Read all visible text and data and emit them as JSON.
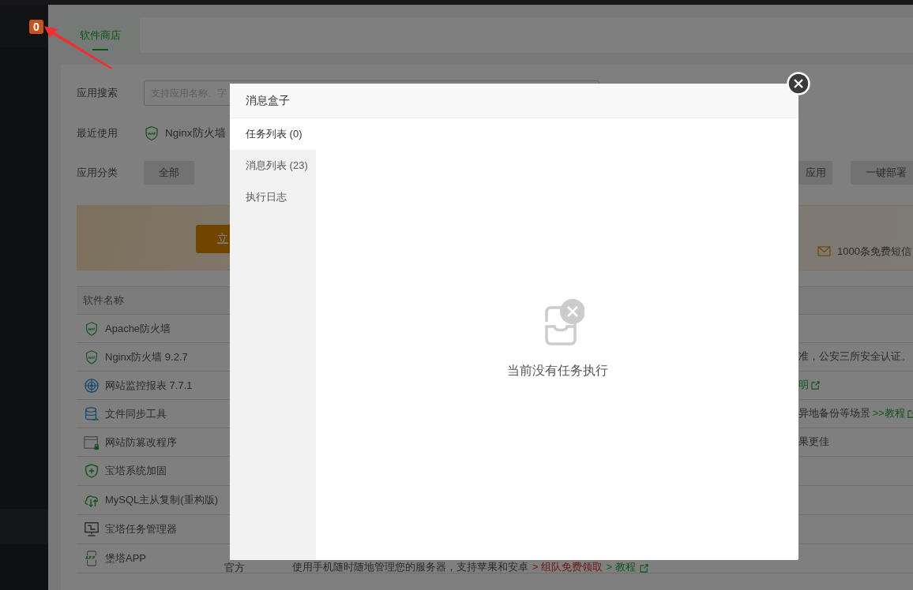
{
  "sidebar": {
    "badge": "0"
  },
  "tabs": [
    {
      "label": "软件商店",
      "selected": true
    }
  ],
  "search": {
    "label": "应用搜索",
    "placeholder": "支持应用名称、字"
  },
  "recent": {
    "label": "最近使用",
    "items": [
      {
        "kind": "waf",
        "label": "Nginx防火墙"
      }
    ]
  },
  "categories": {
    "label": "应用分类",
    "items": [
      {
        "label": "全部"
      }
    ],
    "actions": [
      "应用",
      "一键部署"
    ]
  },
  "banner": {
    "button": "立",
    "sms": "1000条免费短信"
  },
  "table": {
    "columns": [
      "软件名称"
    ],
    "rows": [
      {
        "kind": "waf",
        "name": "Apache防火墙"
      },
      {
        "kind": "waf",
        "name": "Nginx防火墙 9.2.7",
        "note": "准，公安三所安全认证。"
      },
      {
        "kind": "radar",
        "name": "网站监控报表 7.7.1",
        "note_links": [
          {
            "text": "明",
            "kind": "guide"
          }
        ]
      },
      {
        "kind": "database",
        "name": "文件同步工具",
        "note": "异地备份等场景",
        "note_links": [
          {
            "text": ">>教程",
            "kind": "guide"
          }
        ]
      },
      {
        "kind": "browser",
        "name": "网站防篡改程序",
        "note": "果更佳"
      },
      {
        "kind": "shield",
        "name": "宝塔系统加固"
      },
      {
        "kind": "cloud",
        "name": "MySQL主从复制(重构版)"
      },
      {
        "kind": "monitor",
        "name": "宝塔任务管理器"
      },
      {
        "kind": "app",
        "name": "堡塔APP",
        "type": "官方",
        "desc": "使用手机随时随地管理您的服务器，支持苹果和安卓",
        "links": [
          {
            "text": "> 组队免费领取",
            "kind": "promo"
          },
          {
            "text": "> 教程",
            "kind": "guide"
          }
        ]
      }
    ]
  },
  "dialog": {
    "title": "消息盒子",
    "tabs": [
      {
        "label": "任务列表 (0)",
        "selected": true
      },
      {
        "label": "消息列表 (23)",
        "selected": false
      },
      {
        "label": "执行日志",
        "selected": false
      }
    ],
    "empty": "当前没有任务执行"
  }
}
